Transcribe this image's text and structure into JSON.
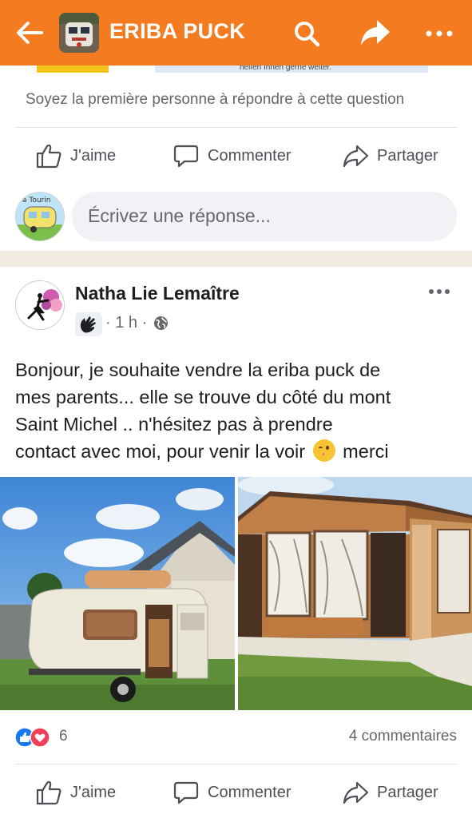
{
  "header": {
    "title": "ERIBA PUCK",
    "back_icon": "arrow-left-icon",
    "search_icon": "search-icon",
    "share_icon": "share-arrow-icon",
    "more_icon": "more-dots-icon",
    "background_color": "#f47b20"
  },
  "previous_image": {
    "caption_fragment": "helfen Ihnen gerne weiter."
  },
  "question": {
    "first_reply_prompt": "Soyez la première personne à répondre à cette question",
    "actions": {
      "like": "J'aime",
      "comment": "Commenter",
      "share": "Partager"
    }
  },
  "composer": {
    "placeholder": "Écrivez une réponse...",
    "avatar_text": "a Tourin"
  },
  "post": {
    "author": "Natha Lie Lemaître",
    "time": "· 1 h ·",
    "privacy_icon": "globe-icon",
    "text_lines": [
      "Bonjour,  je souhaite vendre la eriba puck de",
      "mes parents... elle se trouve du côté du mont",
      "Saint Michel .. n'hésitez pas à prendre",
      "contact avec moi, pour venir la voir"
    ],
    "text_end": "merci",
    "emoji": "winking-face-emoji",
    "photos": [
      "caravan-exterior-photo",
      "caravan-awning-photo"
    ],
    "reaction_count": "6",
    "reactions": [
      "like",
      "love"
    ],
    "comments_count": "4 commentaires",
    "actions": {
      "like": "J'aime",
      "comment": "Commenter",
      "share": "Partager"
    }
  },
  "colors": {
    "accent": "#f47b20",
    "like_blue": "#1877f2",
    "love_red": "#f33e58",
    "secondary_text": "#65676b"
  }
}
